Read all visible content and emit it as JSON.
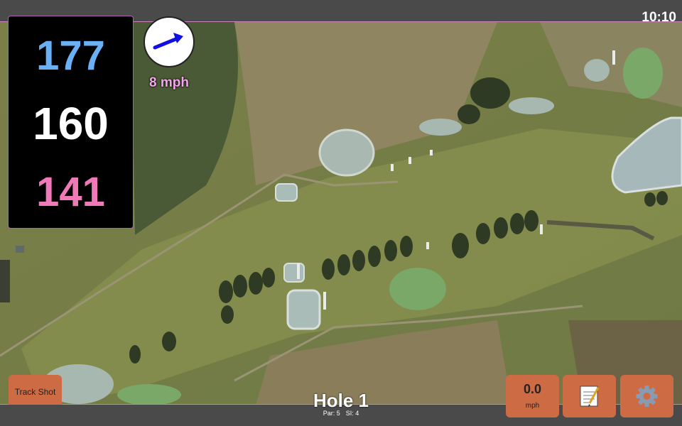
{
  "status_bar": {
    "time": "10:10"
  },
  "distances": {
    "back": "177",
    "center": "160",
    "front": "141"
  },
  "wind": {
    "speed": "8 mph",
    "direction_icon": "arrow-icon",
    "arrow_color": "#1010e0"
  },
  "hole": {
    "title": "Hole 1",
    "par": "Par: 5",
    "stroke_index": "SI: 4"
  },
  "buttons": {
    "track_shot": "Track Shot",
    "speed_value": "0.0",
    "speed_unit": "mph",
    "notes_icon": "notepad-icon",
    "settings_icon": "gear-icon"
  },
  "colors": {
    "back": "#6ab0f5",
    "center": "#ffffff",
    "front": "#f07ab8",
    "button": "#cd6b45",
    "panel_border": "#b060b0"
  }
}
